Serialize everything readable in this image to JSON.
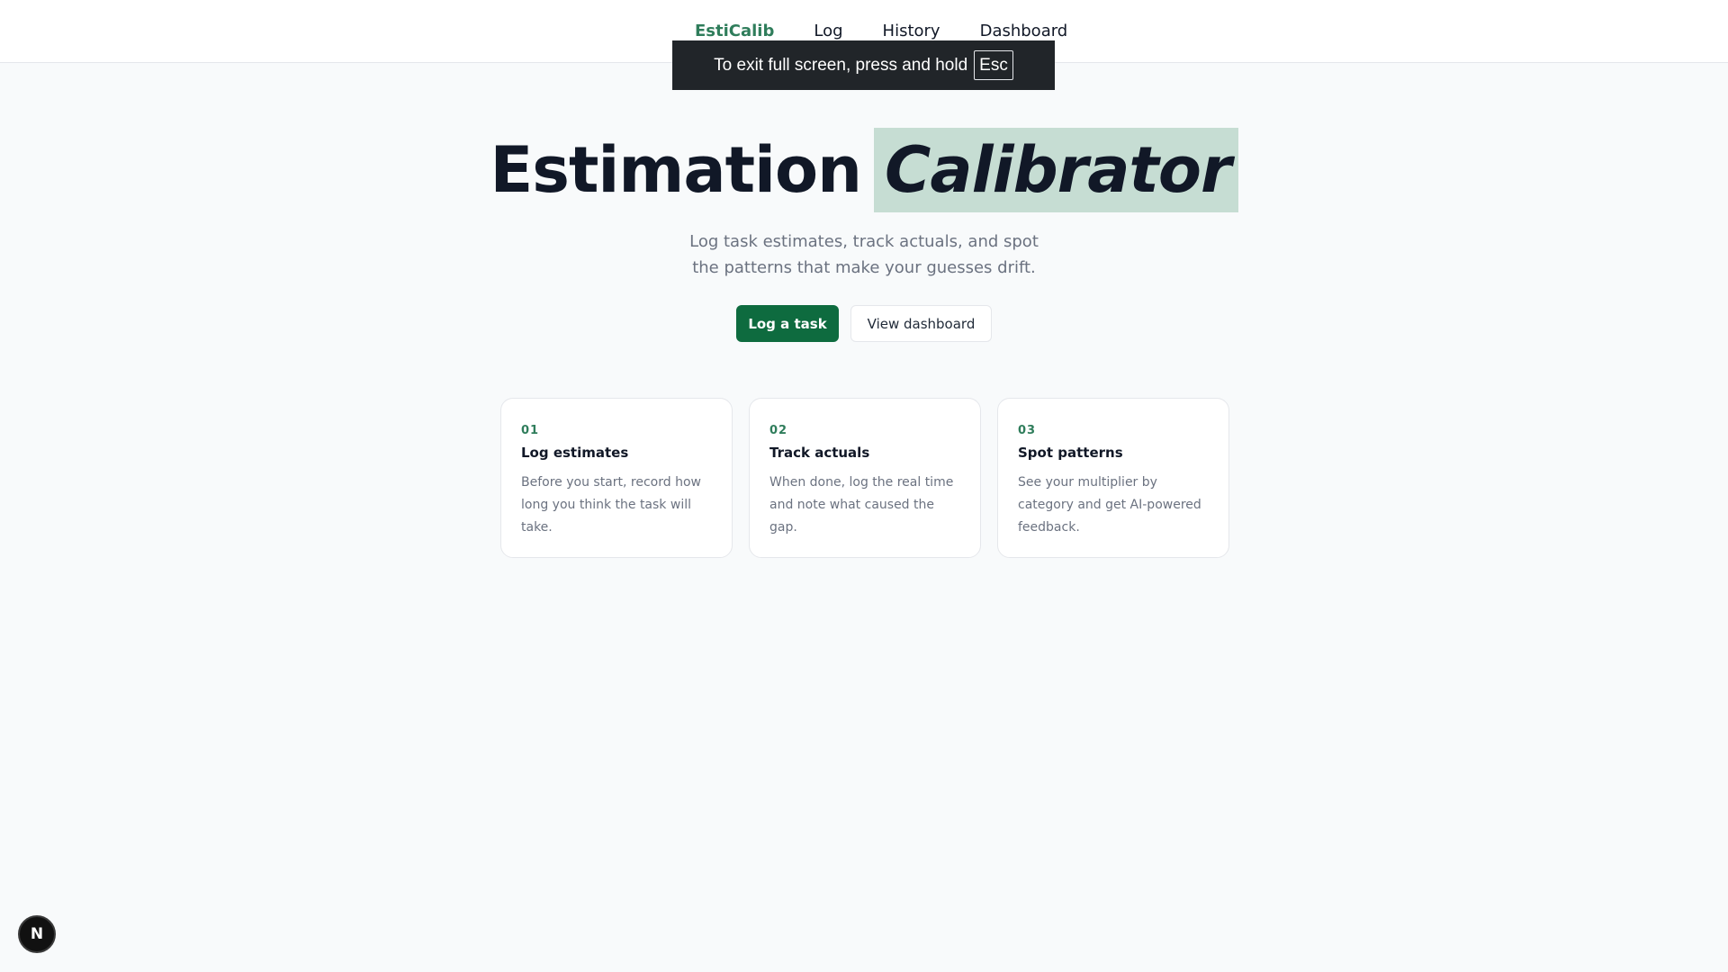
{
  "nav": {
    "brand": "EstiCalib",
    "links": [
      "Log",
      "History",
      "Dashboard"
    ]
  },
  "fullscreen_notice": {
    "text": "To exit full screen, press and hold",
    "key": "Esc"
  },
  "hero": {
    "title_plain": "Estimation",
    "title_highlight": "Calibrator",
    "subtitle": "Log task estimates, track actuals, and spot the patterns that make your guesses drift."
  },
  "actions": {
    "primary_label": "Log a task",
    "secondary_label": "View dashboard"
  },
  "features": [
    {
      "number": "01",
      "title": "Log estimates",
      "description": "Before you start, record how long you think the task will take."
    },
    {
      "number": "02",
      "title": "Track actuals",
      "description": "When done, log the real time and note what caused the gap."
    },
    {
      "number": "03",
      "title": "Spot patterns",
      "description": "See your multiplier by category and get AI-powered feedback."
    }
  ],
  "dev_badge": {
    "letter": "N"
  },
  "colors": {
    "accent": "#2f7d5b",
    "primary_button": "#0e6b3f",
    "highlight": "#c6ddd3",
    "background": "#f8fafb"
  }
}
